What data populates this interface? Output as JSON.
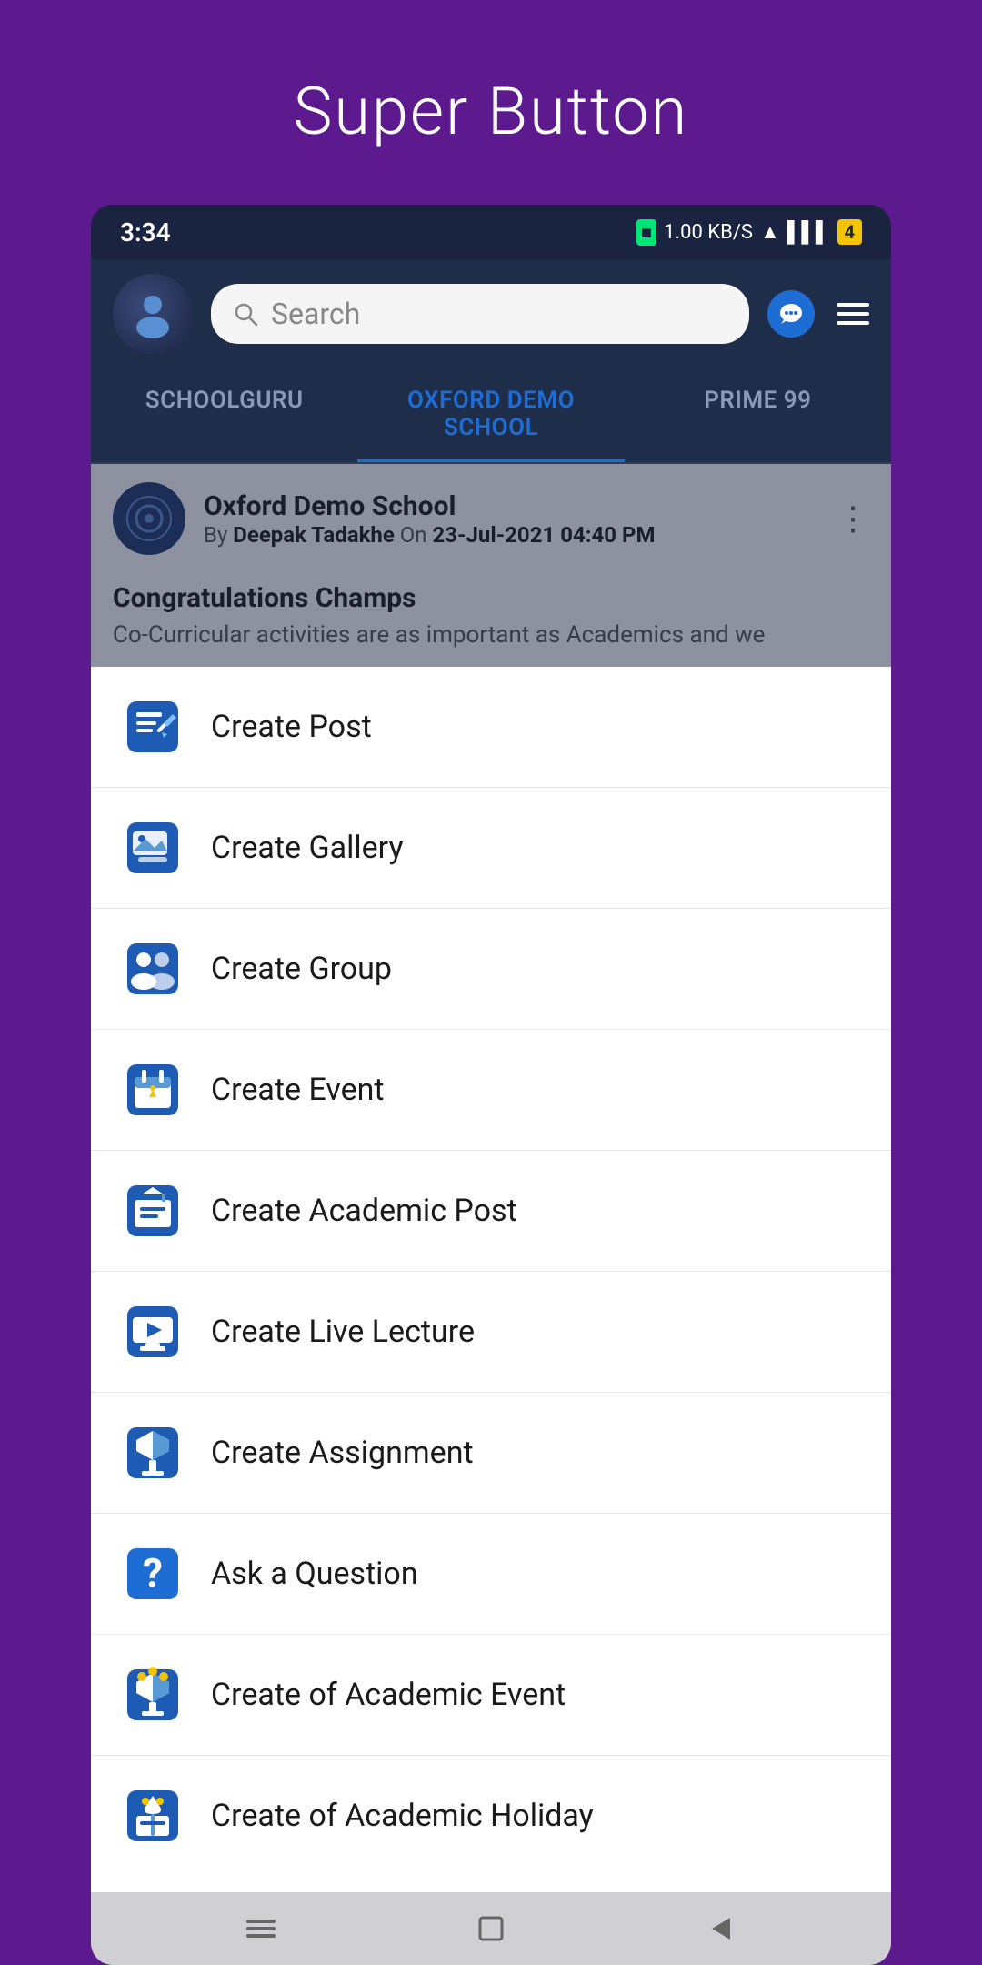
{
  "page": {
    "title": "Super Button"
  },
  "status_bar": {
    "time": "3:34",
    "data_speed": "1.00 KB/S",
    "network": "VoLTE 4G",
    "battery": "4"
  },
  "header": {
    "search_placeholder": "Search",
    "search_text": "Search"
  },
  "tabs": [
    {
      "label": "SCHOOLGURU",
      "active": false
    },
    {
      "label": "OXFORD DEMO SCHOOL",
      "active": true
    },
    {
      "label": "PRIME 99",
      "active": false
    }
  ],
  "post": {
    "school_name": "Oxford Demo School",
    "author": "Deepak Tadakhe",
    "date": "23-Jul-2021 04:40 PM",
    "title": "Congratulations Champs",
    "excerpt": "Co-Curricular activities are as important as Academics and we"
  },
  "menu_items": [
    {
      "id": "create-post",
      "label": "Create Post",
      "icon": "post-icon"
    },
    {
      "id": "create-gallery",
      "label": "Create Gallery",
      "icon": "gallery-icon"
    },
    {
      "id": "create-group",
      "label": "Create Group",
      "icon": "group-icon"
    },
    {
      "id": "create-event",
      "label": "Create Event",
      "icon": "event-icon"
    },
    {
      "id": "create-academic-post",
      "label": "Create Academic Post",
      "icon": "academic-post-icon"
    },
    {
      "id": "create-live-lecture",
      "label": "Create Live Lecture",
      "icon": "live-lecture-icon"
    },
    {
      "id": "create-assignment",
      "label": "Create Assignment",
      "icon": "assignment-icon"
    },
    {
      "id": "ask-question",
      "label": "Ask a Question",
      "icon": "question-icon"
    },
    {
      "id": "create-academic-event",
      "label": "Create of Academic Event",
      "icon": "academic-event-icon"
    },
    {
      "id": "create-academic-holiday",
      "label": "Create of Academic Holiday",
      "icon": "academic-holiday-icon"
    }
  ]
}
